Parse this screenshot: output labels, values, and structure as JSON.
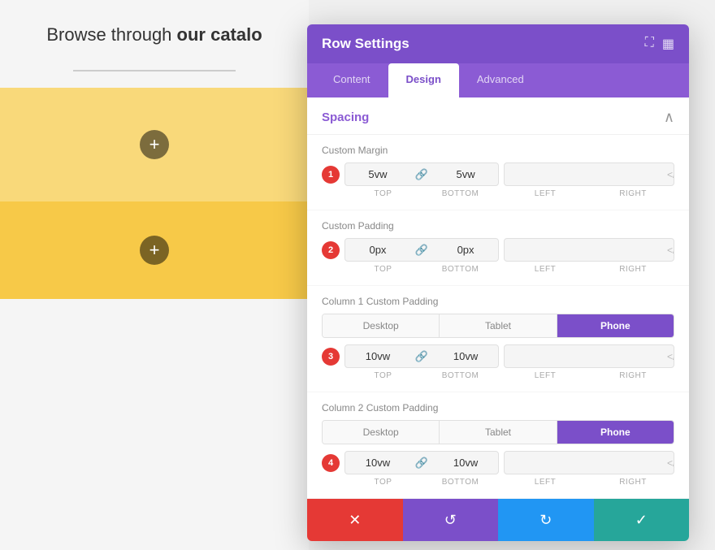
{
  "canvas": {
    "text_before": "Browse through ",
    "text_bold": "our catalo",
    "add_icon": "+",
    "row1_bg": "#f9d97a",
    "row2_bg": "#f7c948"
  },
  "modal": {
    "title": "Row Settings",
    "tabs": [
      {
        "label": "Content",
        "active": false
      },
      {
        "label": "Design",
        "active": true
      },
      {
        "label": "Advanced",
        "active": false
      }
    ],
    "section_title": "Spacing",
    "groups": [
      {
        "id": 1,
        "label": "Custom Margin",
        "badge": "1",
        "top_val": "5vw",
        "bottom_val": "5vw",
        "left_val": "",
        "right_val": "",
        "linked": true,
        "labels": [
          "Top",
          "Bottom",
          "Left",
          "Right"
        ]
      },
      {
        "id": 2,
        "label": "Custom Padding",
        "badge": "2",
        "top_val": "0px",
        "bottom_val": "0px",
        "left_val": "",
        "right_val": "",
        "linked": true,
        "labels": [
          "Top",
          "Bottom",
          "Left",
          "Right"
        ]
      },
      {
        "id": 3,
        "label": "Column 1 Custom Padding",
        "badge": "3",
        "device_tabs": [
          "Desktop",
          "Tablet",
          "Phone"
        ],
        "active_device": "Phone",
        "top_val": "10vw",
        "bottom_val": "10vw",
        "left_val": "",
        "right_val": "",
        "linked": true,
        "labels": [
          "Top",
          "Bottom",
          "Left",
          "Right"
        ]
      },
      {
        "id": 4,
        "label": "Column 2 Custom Padding",
        "badge": "4",
        "device_tabs": [
          "Desktop",
          "Tablet",
          "Phone"
        ],
        "active_device": "Phone",
        "top_val": "10vw",
        "bottom_val": "10vw",
        "left_val": "",
        "right_val": "",
        "linked": true,
        "labels": [
          "Top",
          "Bottom",
          "Left",
          "Right"
        ]
      }
    ],
    "action_buttons": {
      "cancel": "✕",
      "reset": "↺",
      "redo": "↻",
      "save": "✓"
    }
  }
}
